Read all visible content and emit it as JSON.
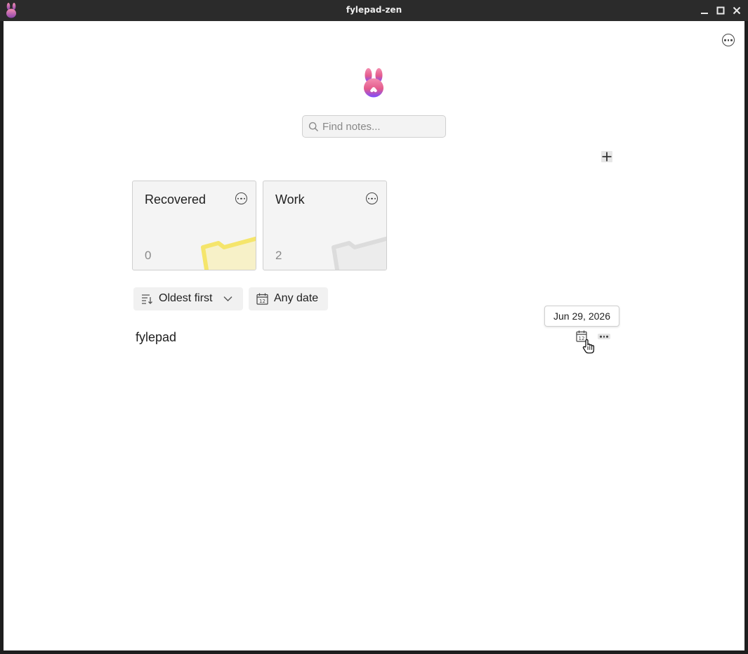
{
  "window": {
    "title": "fylepad-zen"
  },
  "search": {
    "placeholder": "Find notes..."
  },
  "folders": [
    {
      "name": "Recovered",
      "count": "0",
      "accent": "#f5e56b"
    },
    {
      "name": "Work",
      "count": "2",
      "accent": "#d9d9d9"
    }
  ],
  "filters": {
    "sort_label": "Oldest first",
    "date_label": "Any date"
  },
  "notes": [
    {
      "title": "fylepad"
    }
  ],
  "tooltip": {
    "text": "Jun 29, 2026"
  },
  "icons": {
    "top_more": "more-horizontal-circle-icon",
    "add": "plus-icon",
    "search": "search-icon",
    "sort": "sort-icon",
    "calendar": "calendar-icon",
    "chevron": "chevron-down-icon"
  },
  "colors": {
    "brand_gradient_top": "#f06292",
    "brand_gradient_bottom": "#7c4dff",
    "background": "#ffffff",
    "card_background": "#f4f4f4"
  }
}
